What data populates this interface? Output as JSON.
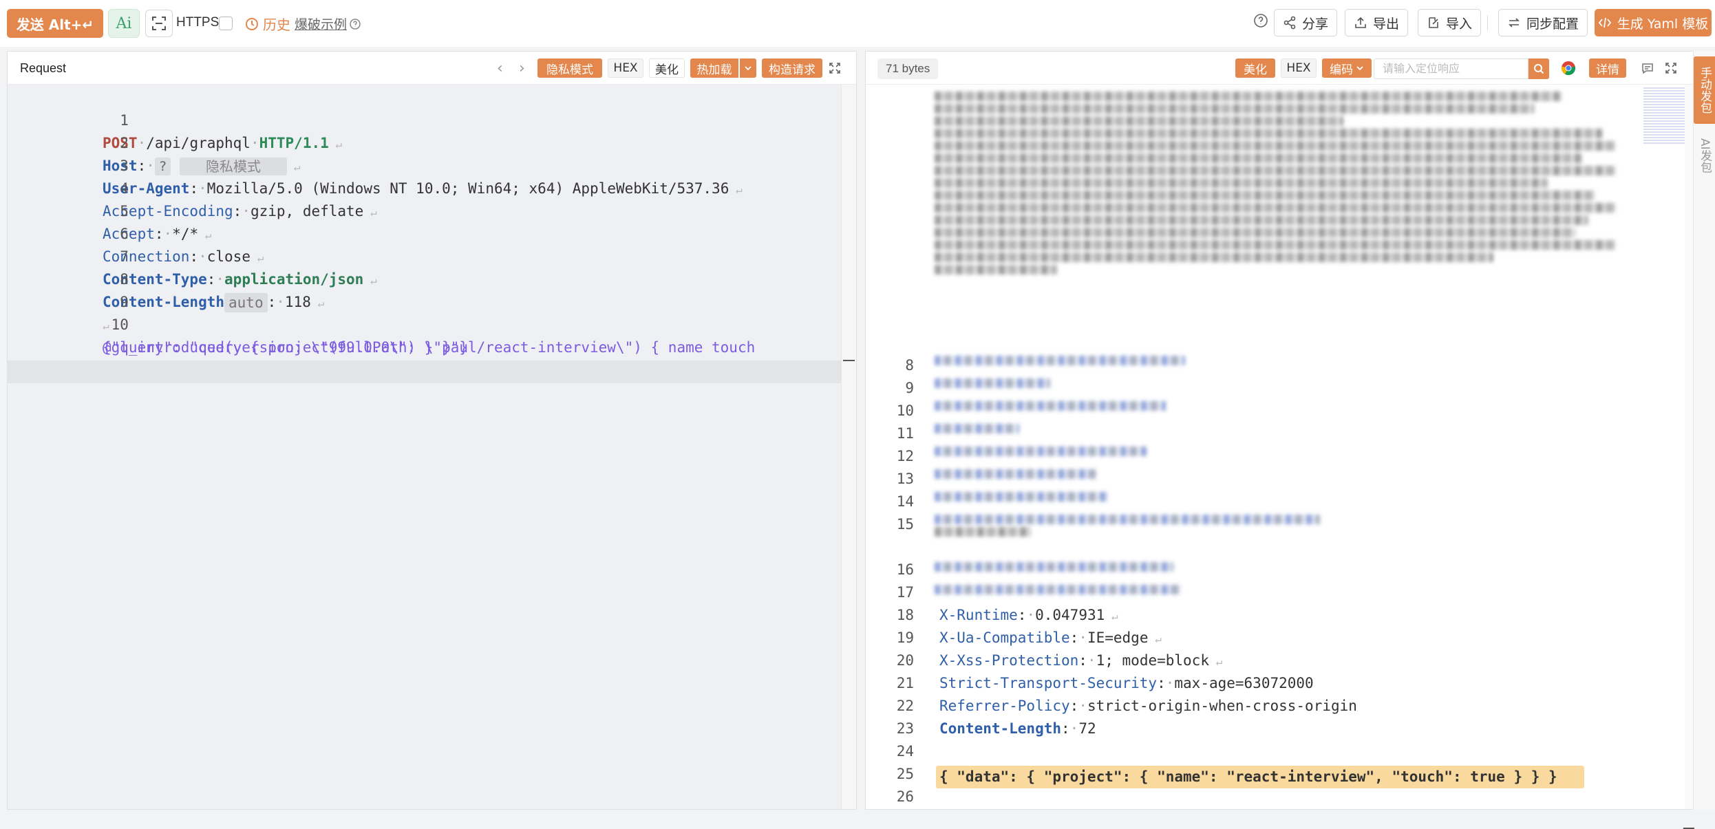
{
  "toolbar": {
    "send_label": "发送 Alt+↵",
    "ai_label": "Ai",
    "https_label": "HTTPS",
    "history_label": "历史",
    "example_label": "爆破示例",
    "share_label": "分享",
    "export_label": "导出",
    "import_label": "导入",
    "sync_label": "同步配置",
    "yaml_label": "生成 Yaml 模板"
  },
  "request": {
    "title": "Request",
    "buttons": {
      "private_mode": "隐私模式",
      "hex": "HEX",
      "beautify": "美化",
      "hot_load": "热加载",
      "build_request": "构造请求"
    },
    "lines": [
      {
        "n": "1"
      },
      {
        "n": "2",
        "host_placeholder": "?",
        "private_badge": "隐私模式"
      },
      {
        "n": "3"
      },
      {
        "n": "4"
      },
      {
        "n": "5"
      },
      {
        "n": "6"
      },
      {
        "n": "7"
      },
      {
        "n": "8",
        "auto_badge": "auto"
      },
      {
        "n": "9"
      },
      {
        "n": "10"
      }
    ],
    "text": {
      "method": "POST",
      "path": "/api/graphql",
      "proto": "HTTP/1.1",
      "host_key": "Host",
      "ua_key": "User-Agent",
      "ua_val": "Mozilla/5.0 (Windows NT 10.0; Win64; x64) AppleWebKit/537.36",
      "ae_key": "Accept-Encoding",
      "ae_val": "gzip, deflate",
      "accept_key": "Accept",
      "accept_val": "*/*",
      "conn_key": "Connection",
      "conn_val": "close",
      "ct_key": "Content-Type",
      "ct_val": "application/json",
      "cl_key": "Content-Length",
      "cl_val": "118",
      "body_line1": "{\"query\": \"query { project(fullPath: \\\"paul/react-interview\\\") { name touch ",
      "body_line2": "@gl_introduced(version: \\\"999.0.0\\\") } }\"}"
    }
  },
  "response": {
    "size": "71 bytes",
    "buttons": {
      "beautify": "美化",
      "hex": "HEX",
      "encoding": "编码",
      "details": "详情"
    },
    "search_placeholder": "请输入定位响应",
    "line_numbers": [
      "8",
      "9",
      "10",
      "11",
      "12",
      "13",
      "14",
      "15",
      "16",
      "17",
      "18",
      "19",
      "20",
      "21",
      "22",
      "23",
      "24",
      "25",
      "26"
    ],
    "headers": [
      {
        "key": "X-Runtime",
        "val": "0.047931"
      },
      {
        "key": "X-Ua-Compatible",
        "val": "IE=edge"
      },
      {
        "key": "X-Xss-Protection",
        "val": "1; mode=block"
      },
      {
        "key": "Strict-Transport-Security",
        "val": "max-age=63072000"
      },
      {
        "key": "Referrer-Policy",
        "val": "strict-origin-when-cross-origin"
      },
      {
        "key": "Content-Length",
        "val": "72"
      }
    ],
    "body": "{ \"data\": { \"project\": { \"name\": \"react-interview\", \"touch\": true } } }"
  },
  "side_tabs": {
    "manual": "手动发包",
    "ai": "AI发包"
  },
  "colors": {
    "accent": "#e3874d",
    "highlight": "#f9d99e"
  }
}
